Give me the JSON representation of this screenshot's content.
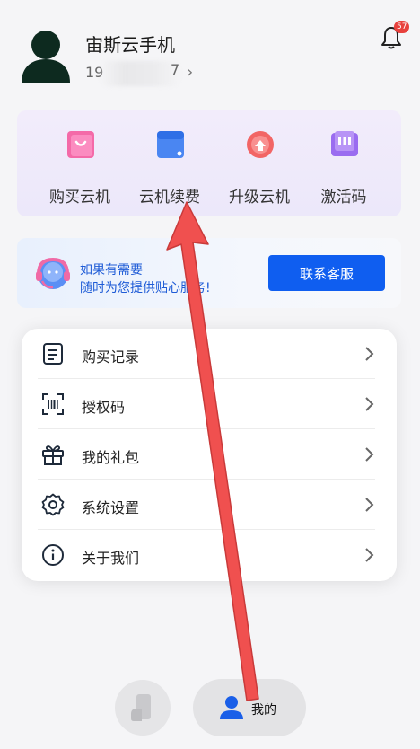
{
  "profile": {
    "name": "宙斯云手机",
    "phone_prefix": "19",
    "phone_suffix": "7"
  },
  "notifications": {
    "badge_count": "57"
  },
  "quick_actions": [
    {
      "label": "购买云机",
      "icon": "shopping-bag-icon",
      "color": "#f0569b"
    },
    {
      "label": "云机续费",
      "icon": "renew-card-icon",
      "color": "#3a7df0"
    },
    {
      "label": "升级云机",
      "icon": "upgrade-icon",
      "color": "#ef4f4f"
    },
    {
      "label": "激活码",
      "icon": "activation-code-icon",
      "color": "#8a56e8"
    }
  ],
  "service": {
    "line1": "如果有需要",
    "line2": "随时为您提供贴心服务!",
    "button": "联系客服"
  },
  "menu": [
    {
      "label": "购买记录",
      "icon": "purchase-record-icon"
    },
    {
      "label": "授权码",
      "icon": "auth-code-scan-icon"
    },
    {
      "label": "我的礼包",
      "icon": "gift-icon"
    },
    {
      "label": "系统设置",
      "icon": "settings-gear-icon"
    },
    {
      "label": "关于我们",
      "icon": "info-icon"
    }
  ],
  "tabbar": {
    "mine_label": "我的"
  },
  "colors": {
    "primary": "#0f5ef0",
    "annotation_arrow": "#f0504f",
    "badge": "#e8413d"
  }
}
